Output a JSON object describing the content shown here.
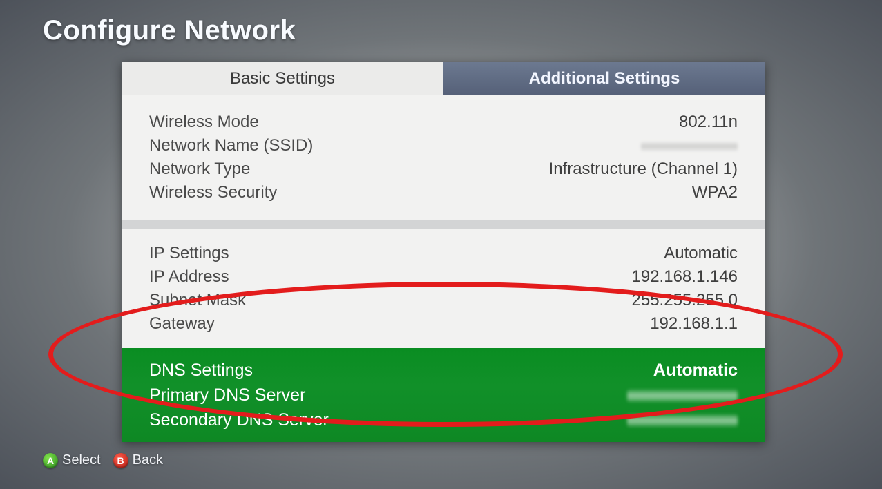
{
  "title": "Configure Network",
  "tabs": {
    "basic": "Basic Settings",
    "additional": "Additional Settings"
  },
  "wireless": {
    "mode_label": "Wireless Mode",
    "mode_value": "802.11n",
    "ssid_label": "Network Name (SSID)",
    "ssid_value": "",
    "type_label": "Network Type",
    "type_value": "Infrastructure (Channel 1)",
    "security_label": "Wireless Security",
    "security_value": "WPA2"
  },
  "ip": {
    "settings_label": "IP Settings",
    "settings_value": "Automatic",
    "address_label": "IP Address",
    "address_value": "192.168.1.146",
    "subnet_label": "Subnet Mask",
    "subnet_value": "255.255.255.0",
    "gateway_label": "Gateway",
    "gateway_value": "192.168.1.1"
  },
  "dns": {
    "settings_label": "DNS Settings",
    "settings_value": "Automatic",
    "primary_label": "Primary DNS Server",
    "primary_value": "",
    "secondary_label": "Secondary DNS Server",
    "secondary_value": ""
  },
  "footer": {
    "a_glyph": "A",
    "a_label": "Select",
    "b_glyph": "B",
    "b_label": "Back"
  }
}
